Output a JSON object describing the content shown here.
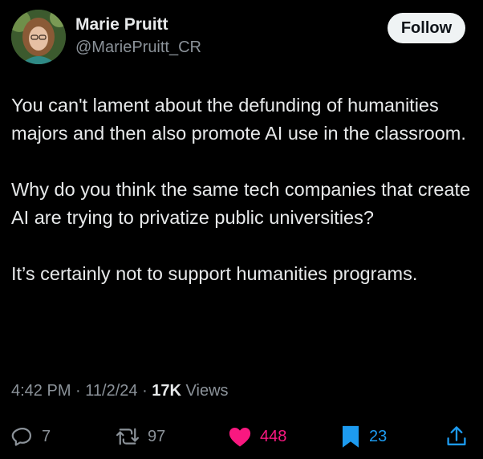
{
  "author": {
    "display_name": "Marie Pruitt",
    "handle": "@MariePruitt_CR"
  },
  "follow_label": "Follow",
  "tweet": {
    "paragraphs": [
      "You can't lament about the defunding of humanities majors and then also promote AI use in the classroom.",
      "Why do you think the same tech companies that create AI are trying to privatize public universities?",
      "It’s certainly not to support humanities programs."
    ]
  },
  "meta": {
    "time": "4:42 PM",
    "separator": " · ",
    "date": "11/2/24",
    "views_count": "17K",
    "views_label": " Views"
  },
  "actions": {
    "replies": "7",
    "reposts": "97",
    "likes": "448",
    "bookmarks": "23"
  },
  "colors": {
    "background": "#000000",
    "text": "#e7e9ea",
    "secondary": "#8b9299",
    "like": "#f91880",
    "bookmark": "#1d9bf0",
    "follow_bg": "#eff3f4"
  },
  "icons": [
    "reply-icon",
    "repost-icon",
    "heart-icon",
    "bookmark-icon",
    "share-icon"
  ]
}
